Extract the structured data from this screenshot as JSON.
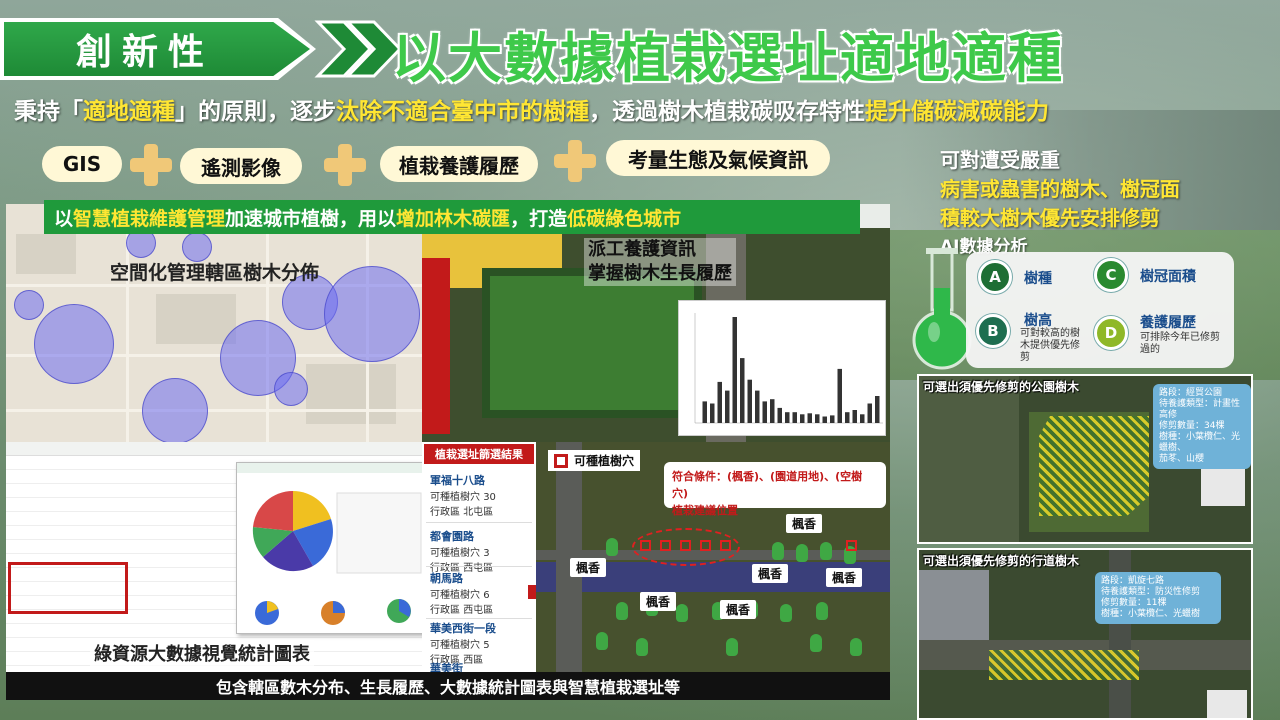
{
  "header": {
    "tab_label": "創新性",
    "title": "以大數據植栽選址適地適種"
  },
  "subtitle": {
    "part1": "秉持「",
    "hl1": "適地適種",
    "part2": "」的原則，逐步",
    "hl2": "汰除不適合臺中市的樹種",
    "part3": "，透過樹木植栽碳吸存特性",
    "hl3": "提升儲碳減碳能力"
  },
  "pills": {
    "gis": "GIS",
    "remote": "遙測影像",
    "history": "植栽養護履歷",
    "eco": "考量生態及氣候資訊"
  },
  "right_text": {
    "line1": "可對遭受嚴重",
    "line2": "病害或蟲害的樹木、樹冠面",
    "line3": "積較大樹木優先安排修剪",
    "ai_label": "AI數據分析"
  },
  "ai_items": [
    {
      "letter": "A",
      "name": "樹種",
      "desc": ""
    },
    {
      "letter": "B",
      "name": "樹高",
      "desc": "可對較高的樹木提供優先修剪"
    },
    {
      "letter": "C",
      "name": "樹冠面積",
      "desc": ""
    },
    {
      "letter": "D",
      "name": "養護履歷",
      "desc": "可排除今年已修剪過的"
    }
  ],
  "banner": {
    "p1": "以",
    "h1": "智慧植栽維護管理",
    "p2": "加速城市植樹，用以",
    "h2": "增加林木碳匯",
    "p3": "，打造",
    "h3": "低碳綠色城市"
  },
  "map_label": "空間化管理轄區樹木分佈",
  "sat_label": {
    "line1": "派工養護資訊",
    "line2": "掌握樹木生長履歷"
  },
  "stats_label": "綠資源大數據視覺統計圖表",
  "selection": {
    "title": "植栽選址篩選結果",
    "items": [
      {
        "name": "軍福十八路",
        "count_label": "可種植樹穴",
        "count": "30",
        "district_label": "行政區",
        "district": "北屯區"
      },
      {
        "name": "都會園路",
        "count_label": "可種植樹穴",
        "count": "3",
        "district_label": "行政區",
        "district": "西屯區"
      },
      {
        "name": "朝馬路",
        "count_label": "可種植樹穴",
        "count": "6",
        "district_label": "行政區",
        "district": "西屯區"
      },
      {
        "name": "華美西街一段",
        "count_label": "可種植樹穴",
        "count": "5",
        "district_label": "行政區",
        "district": "西區"
      },
      {
        "name": "華美街",
        "count_label": "",
        "count": "",
        "district_label": "",
        "district": ""
      }
    ]
  },
  "site": {
    "plantable": "可種植樹穴",
    "criteria": "符合條件：(楓香)、(園道用地)、(空樹穴)",
    "suggest": "植栽建議位置",
    "species_tags": [
      "楓香",
      "楓香",
      "楓香",
      "楓香",
      "楓香",
      "楓香"
    ]
  },
  "caption": "包含轄區數木分布、生長履歷、大數據統計圖表與智慧植栽選址等",
  "right_images": [
    {
      "label": "可選出須優先修剪的公園樹木",
      "info": [
        "路段：經貿公園",
        "待養護類型：計畫性高修",
        "修剪數量：34棵",
        "樹種：小葉欖仁、光蠟樹、",
        "茄苳、山櫻"
      ]
    },
    {
      "label": "可選出須優先修剪的行道樹木",
      "info": [
        "路段：凱旋七路",
        "待養護類型：防災性修剪",
        "修剪數量：11棵",
        "樹種：小葉欖仁、光蠟樹"
      ]
    }
  ],
  "chart_data": {
    "type": "bar",
    "values": [
      20,
      18,
      38,
      30,
      98,
      60,
      40,
      30,
      20,
      22,
      14,
      10,
      10,
      8,
      9,
      8,
      6,
      7,
      50,
      10,
      12,
      8,
      18,
      25
    ]
  },
  "colors": {
    "accent_green": "#1f9a3b",
    "title_green": "#3ec94a",
    "highlight_yellow": "#ffe633",
    "alert_red": "#c21a1a"
  }
}
